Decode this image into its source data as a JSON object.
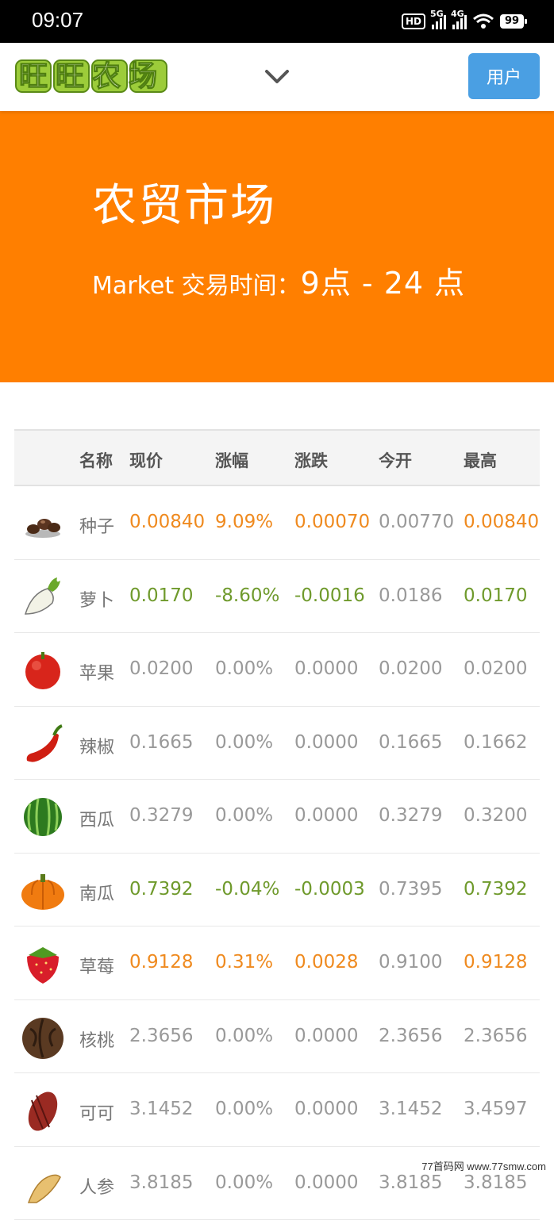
{
  "status_bar": {
    "time": "09:07",
    "hd_label": "HD",
    "net1": "5G",
    "net2": "4G",
    "battery": "99"
  },
  "header": {
    "logo_text": "旺旺农场",
    "user_button": "用户"
  },
  "banner": {
    "title": "农贸市场",
    "subtitle_prefix": "Market 交易时间：",
    "hours": "9点 - 24 点"
  },
  "table": {
    "headers": [
      "名称",
      "现价",
      "涨幅",
      "涨跌",
      "今开",
      "最高"
    ],
    "rows": [
      {
        "name": "种子",
        "price": "0.00840",
        "pct": "9.09%",
        "change": "0.00070",
        "open": "0.00770",
        "high": "0.00840",
        "trend": "up",
        "icon": "seed-icon"
      },
      {
        "name": "萝卜",
        "price": "0.0170",
        "pct": "-8.60%",
        "change": "-0.0016",
        "open": "0.0186",
        "high": "0.0170",
        "trend": "down",
        "icon": "radish-icon"
      },
      {
        "name": "苹果",
        "price": "0.0200",
        "pct": "0.00%",
        "change": "0.0000",
        "open": "0.0200",
        "high": "0.0200",
        "trend": "flat",
        "icon": "apple-icon"
      },
      {
        "name": "辣椒",
        "price": "0.1665",
        "pct": "0.00%",
        "change": "0.0000",
        "open": "0.1665",
        "high": "0.1662",
        "trend": "flat",
        "icon": "chili-icon"
      },
      {
        "name": "西瓜",
        "price": "0.3279",
        "pct": "0.00%",
        "change": "0.0000",
        "open": "0.3279",
        "high": "0.3200",
        "trend": "flat",
        "icon": "watermelon-icon"
      },
      {
        "name": "南瓜",
        "price": "0.7392",
        "pct": "-0.04%",
        "change": "-0.0003",
        "open": "0.7395",
        "high": "0.7392",
        "trend": "down",
        "icon": "pumpkin-icon"
      },
      {
        "name": "草莓",
        "price": "0.9128",
        "pct": "0.31%",
        "change": "0.0028",
        "open": "0.9100",
        "high": "0.9128",
        "trend": "up",
        "icon": "strawberry-icon"
      },
      {
        "name": "核桃",
        "price": "2.3656",
        "pct": "0.00%",
        "change": "0.0000",
        "open": "2.3656",
        "high": "2.3656",
        "trend": "flat",
        "icon": "walnut-icon"
      },
      {
        "name": "可可",
        "price": "3.1452",
        "pct": "0.00%",
        "change": "0.0000",
        "open": "3.1452",
        "high": "3.4597",
        "trend": "flat",
        "icon": "cocoa-icon"
      },
      {
        "name": "人参",
        "price": "3.8185",
        "pct": "0.00%",
        "change": "0.0000",
        "open": "3.8185",
        "high": "3.8185",
        "trend": "flat",
        "icon": "ginseng-icon"
      }
    ]
  },
  "colors": {
    "banner": "#ff7f00",
    "up": "#ef8a1f",
    "down": "#6f9a2c",
    "flat": "#999999",
    "button": "#4a9fe3"
  },
  "watermark": "77首码网 www.77smw.com"
}
